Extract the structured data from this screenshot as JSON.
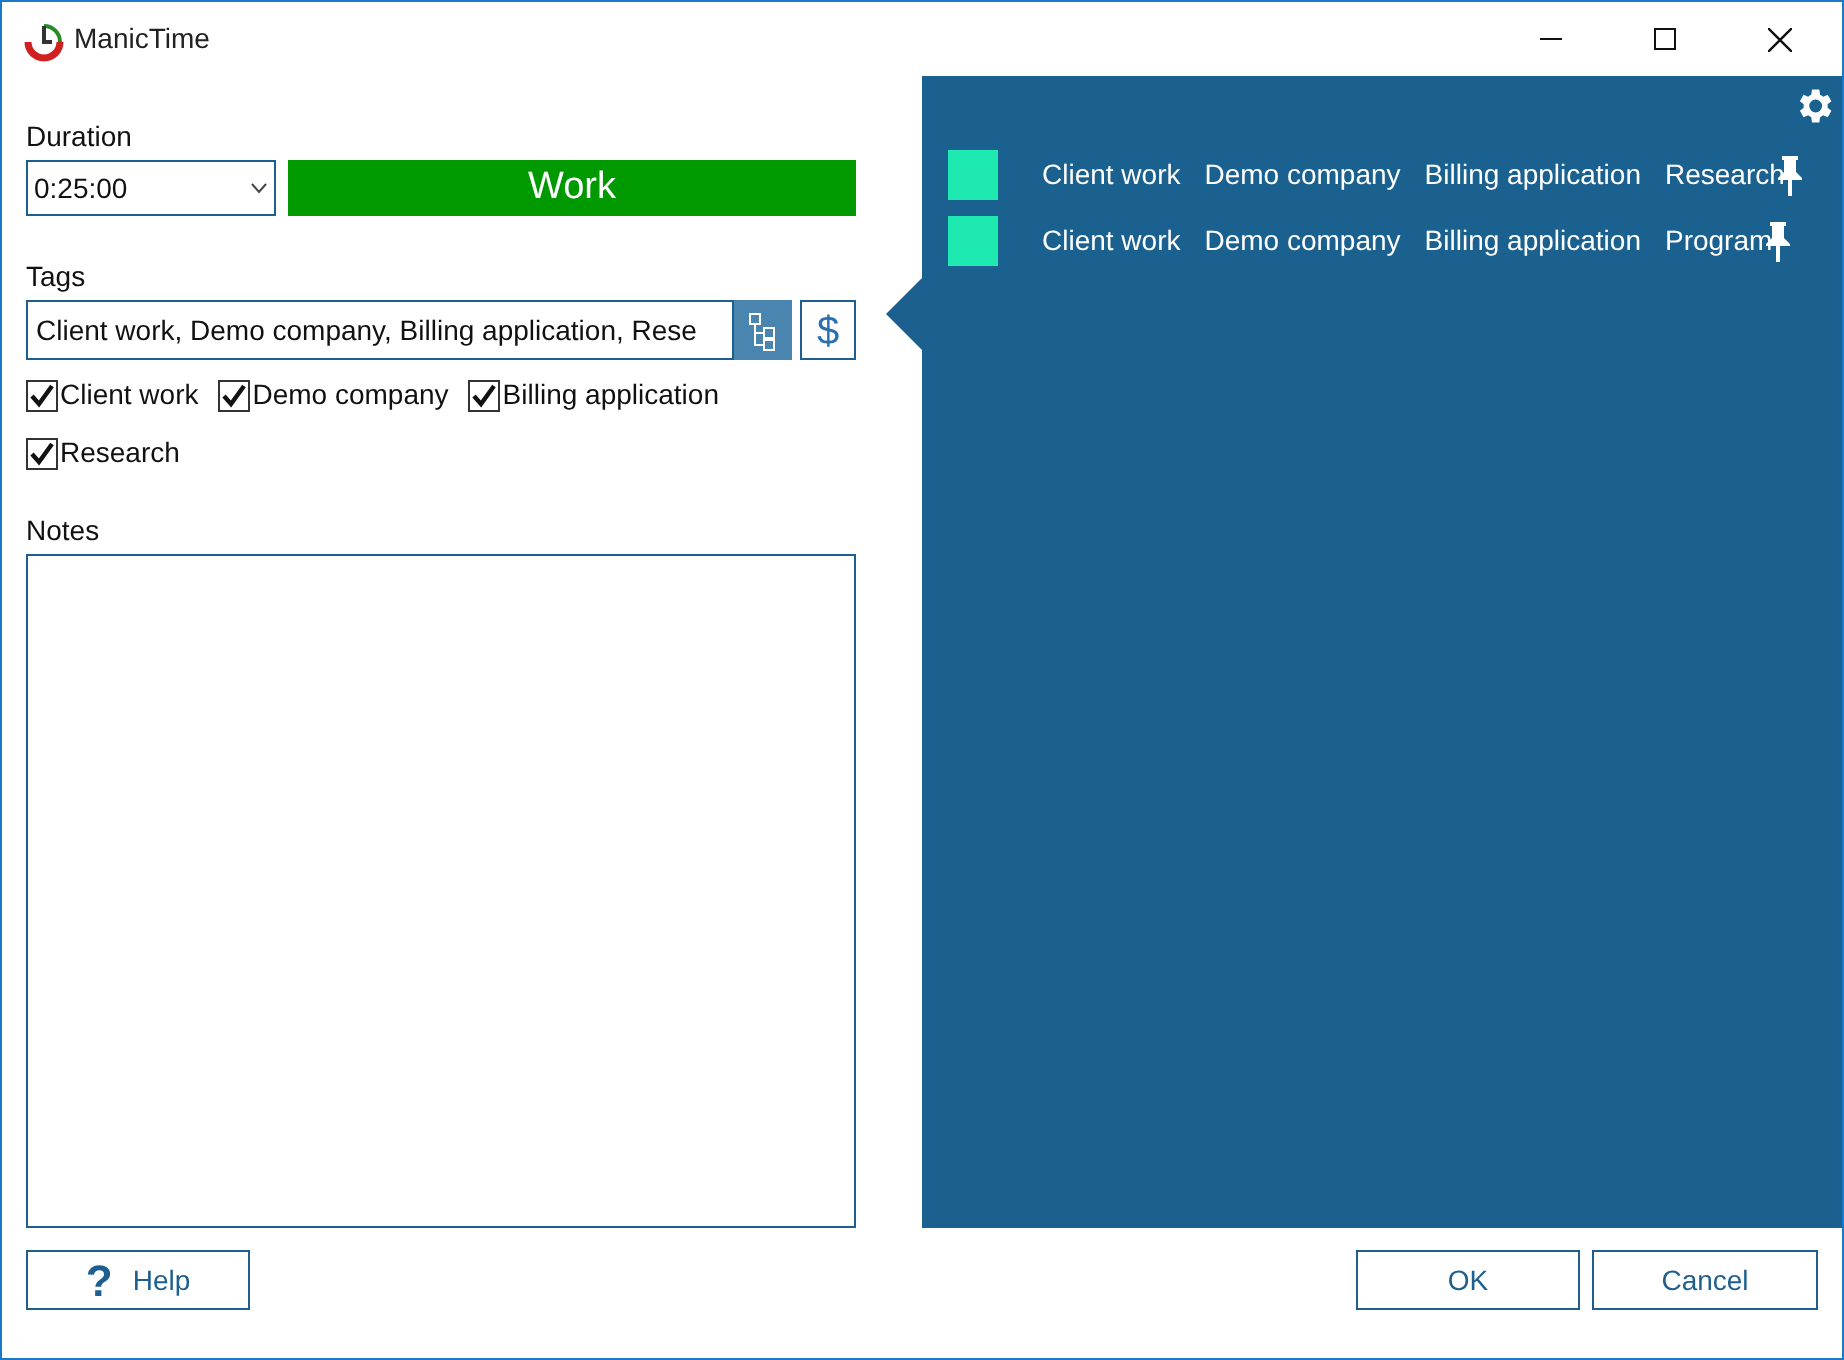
{
  "window": {
    "title": "ManicTime"
  },
  "duration": {
    "label": "Duration",
    "value": "0:25:00"
  },
  "activity": {
    "label": "Work",
    "color": "#009900"
  },
  "tags": {
    "label": "Tags",
    "value": "Client work, Demo company, Billing application, Rese",
    "money_button": "$",
    "options": [
      {
        "label": "Client work",
        "checked": true
      },
      {
        "label": "Demo company",
        "checked": true
      },
      {
        "label": "Billing application",
        "checked": true
      },
      {
        "label": "Research",
        "checked": true
      }
    ]
  },
  "notes": {
    "label": "Notes"
  },
  "suggestions": [
    {
      "color": "#1de9b0",
      "tags": [
        "Client work",
        "Demo company",
        "Billing application",
        "Research"
      ]
    },
    {
      "color": "#1de9b0",
      "tags": [
        "Client work",
        "Demo company",
        "Billing application",
        "Program"
      ]
    }
  ],
  "buttons": {
    "help": "Help",
    "help_icon": "?",
    "ok": "OK",
    "cancel": "Cancel"
  }
}
